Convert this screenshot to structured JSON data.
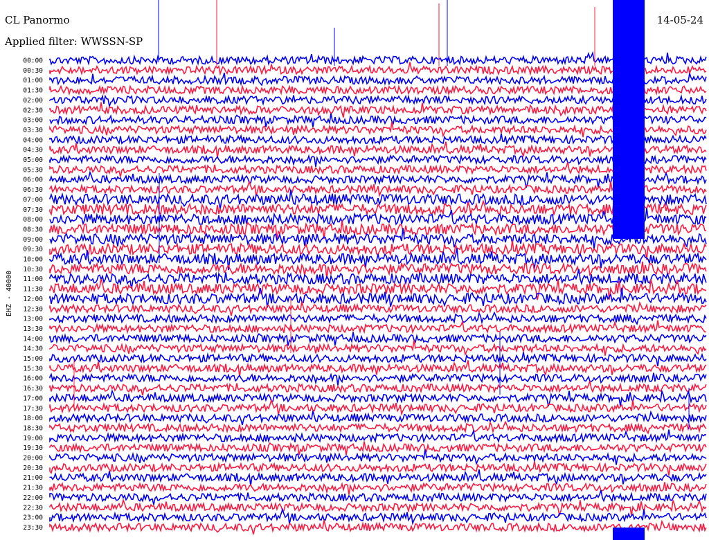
{
  "header": {
    "station": "CL Panormo",
    "filter": "Applied filter: WWSSN-SP",
    "date": "14-05-24"
  },
  "chart_data": {
    "type": "line",
    "title": "CL Panormo",
    "subtitle": "Applied filter: WWSSN-SP",
    "ylabel": "EHZ - 40000",
    "row_labels": [
      "00:00",
      "00:30",
      "01:00",
      "01:30",
      "02:00",
      "02:30",
      "03:00",
      "03:30",
      "04:00",
      "04:30",
      "05:00",
      "05:30",
      "06:00",
      "06:30",
      "07:00",
      "07:30",
      "08:00",
      "08:30",
      "09:00",
      "09:30",
      "10:00",
      "10:30",
      "11:00",
      "11:30",
      "12:00",
      "12:30",
      "13:00",
      "13:30",
      "14:00",
      "14:30",
      "15:00",
      "15:30",
      "16:00",
      "16:30",
      "17:00",
      "17:30",
      "18:00",
      "18:30",
      "19:00",
      "19:30",
      "20:00",
      "20:30",
      "21:00",
      "21:30",
      "22:00",
      "22:30",
      "23:00",
      "23:30"
    ],
    "trace_colors": [
      "#0000ff",
      "#ff1a40"
    ],
    "grid": false,
    "legend": "none"
  }
}
